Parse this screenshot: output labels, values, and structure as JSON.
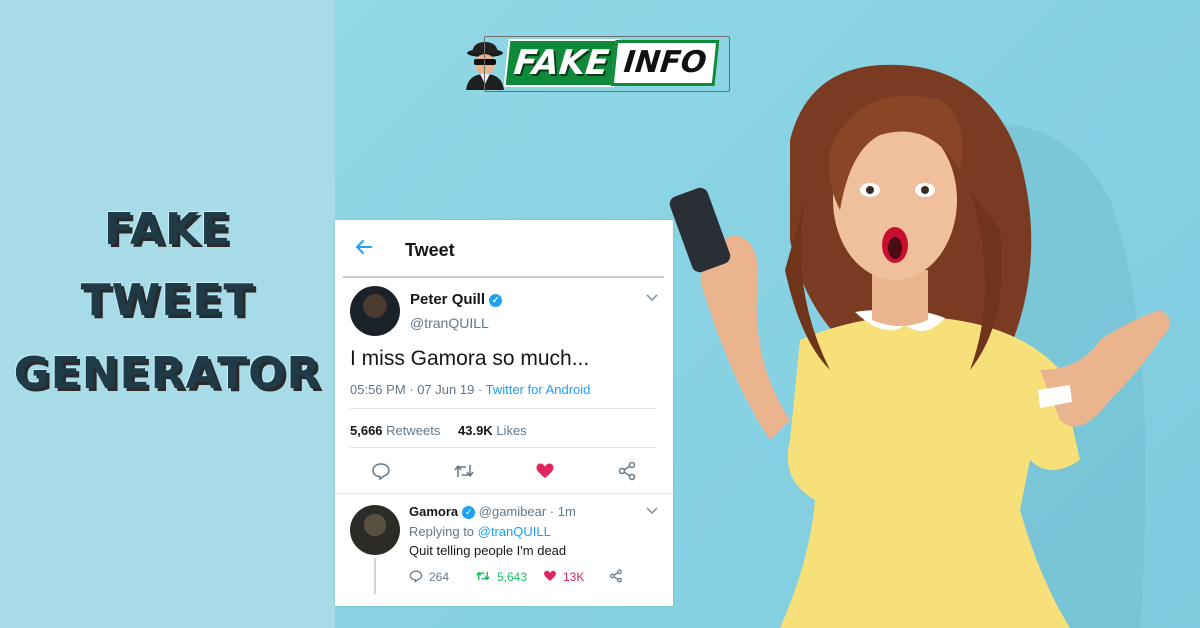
{
  "headline": {
    "line1": "FAKE",
    "line2": "TWEET",
    "line3": "GENERATOR"
  },
  "logo": {
    "word1": "FAKE",
    "word2": "INFO",
    "icon": "spy-icon"
  },
  "tweet": {
    "header": {
      "back_icon": "back-arrow-icon",
      "title": "Tweet"
    },
    "author": {
      "name": "Peter Quill",
      "handle": "@tranQUILL",
      "verified": true
    },
    "text": "I miss Gamora so much...",
    "time": "05:56 PM · 07 Jun 19 · ",
    "source": "Twitter for Android",
    "stats": {
      "retweets_count": "5,666",
      "retweets_label": "Retweets",
      "likes_count": "43.9K",
      "likes_label": "Likes"
    },
    "actions": [
      "reply-icon",
      "retweet-icon",
      "like-icon",
      "share-icon"
    ]
  },
  "reply": {
    "name": "Gamora",
    "handle_time": "@gamibear · 1m",
    "replying_prefix": "Replying to ",
    "replying_handle": "@tranQUILL",
    "text": "Quit telling people I'm dead",
    "counts": {
      "replies": "264",
      "retweets": "5,643",
      "likes": "13K"
    }
  },
  "colors": {
    "twitter_blue": "#1da1f2",
    "like_red": "#e0245e",
    "retweet_green": "#17bf63",
    "headline": "#1f3b47",
    "logo_green": "#0f8a3a",
    "background": "#8fd4e3"
  }
}
